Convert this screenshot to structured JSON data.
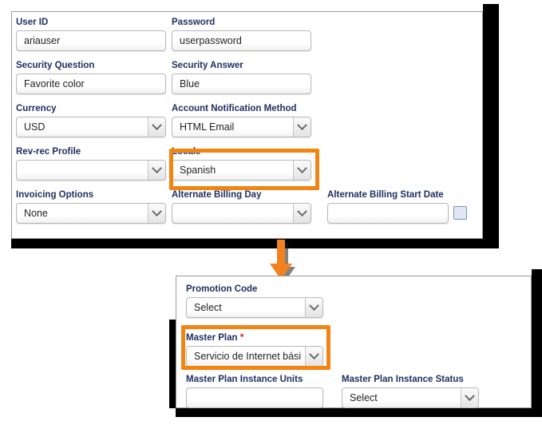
{
  "theme": {
    "label_color": "#1f2f60",
    "highlight_color": "#f28412",
    "required_color": "#e02020",
    "arrow_color": "#f4811f"
  },
  "top_panel": {
    "fields": [
      {
        "label": "User ID",
        "value": "ariauser",
        "type": "text"
      },
      {
        "label": "Password",
        "value": "userpassword",
        "type": "text"
      },
      {
        "label": "Security Question",
        "value": "Favorite color",
        "type": "text"
      },
      {
        "label": "Security Answer",
        "value": "Blue",
        "type": "text"
      },
      {
        "label": "Currency",
        "value": "USD",
        "type": "select"
      },
      {
        "label": "Account Notification Method",
        "value": "HTML Email",
        "type": "select"
      },
      {
        "label": "Rev-rec Profile",
        "value": "",
        "type": "select"
      },
      {
        "label": "Locale",
        "value": "Spanish",
        "type": "select"
      },
      {
        "label": "Invoicing Options",
        "value": "None",
        "type": "select"
      },
      {
        "label": "Alternate Billing Day",
        "value": "",
        "type": "select"
      },
      {
        "label": "Alternate Billing Start Date",
        "value": "",
        "type": "text"
      }
    ],
    "date_picker_icon": "calendar-icon"
  },
  "bottom_panel": {
    "fields": [
      {
        "label": "Promotion Code",
        "value": "Select",
        "type": "select",
        "required": false
      },
      {
        "label": "Master Plan",
        "value": "Servicio de Internet bási",
        "type": "select",
        "required": true
      },
      {
        "label": "Master Plan Instance Units",
        "value": "",
        "type": "text",
        "required": false
      },
      {
        "label": "Master Plan Instance Status",
        "value": "Select",
        "type": "select",
        "required": false
      }
    ],
    "required_marker": "*"
  },
  "annotations": {
    "highlight_locale": "Locale",
    "highlight_master_plan": "Master Plan",
    "connector_arrow": "down-arrow-icon"
  }
}
